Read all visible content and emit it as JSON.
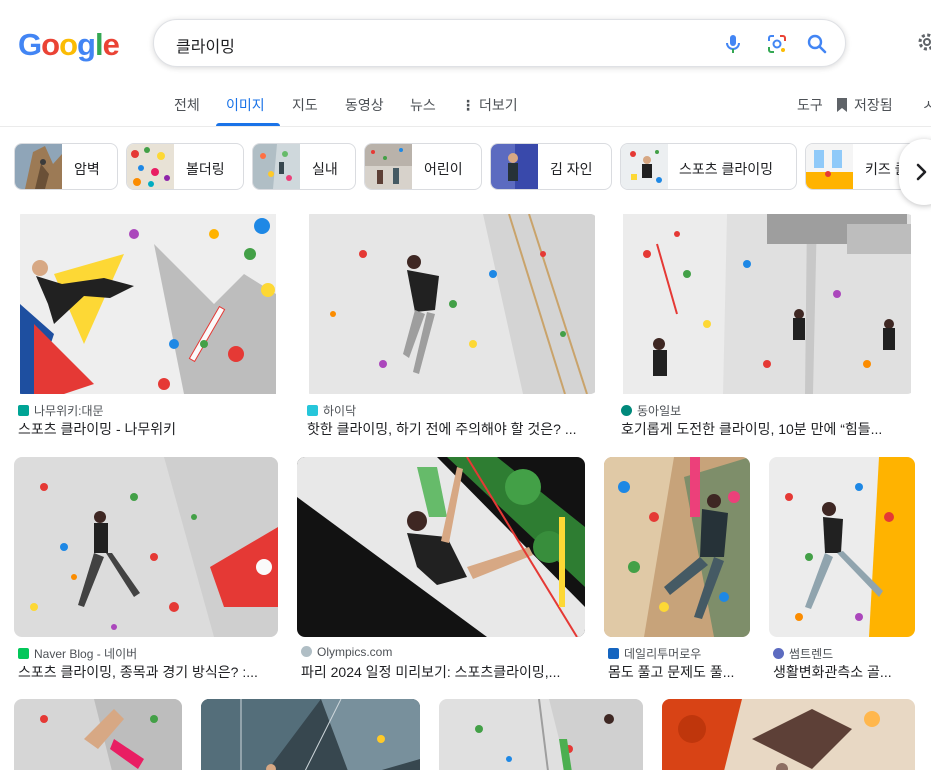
{
  "logo": [
    "G",
    "o",
    "o",
    "g",
    "l",
    "e"
  ],
  "search": {
    "query": "클라이밍"
  },
  "tabs": [
    {
      "label": "전체"
    },
    {
      "label": "이미지"
    },
    {
      "label": "지도"
    },
    {
      "label": "동영상"
    },
    {
      "label": "뉴스"
    },
    {
      "label": "더보기"
    },
    {
      "label": "도구"
    },
    {
      "label": "저장됨"
    }
  ],
  "chips": [
    {
      "label": "암벽"
    },
    {
      "label": "볼더링"
    },
    {
      "label": "실내"
    },
    {
      "label": "어린이"
    },
    {
      "label": "김 자인"
    },
    {
      "label": "스포츠 클라이밍"
    },
    {
      "label": "키즈 클"
    }
  ],
  "results": [
    {
      "source": "나무위키:대문",
      "title": "스포츠 클라이밍 - 나무위키"
    },
    {
      "source": "하이닥",
      "title": "핫한 클라이밍, 하기 전에 주의해야 할 것은? ..."
    },
    {
      "source": "동아일보",
      "title": "호기롭게 도전한 클라이밍, 10분 만에 “힘들..."
    },
    {
      "source": "Naver Blog - 네이버",
      "title": "스포츠 클라이밍, 종목과 경기 방식은? :..."
    },
    {
      "source": "Olympics.com",
      "title": "파리 2024 일정 미리보기: 스포츠클라이밍,..."
    },
    {
      "source": "데일리투머로우",
      "title": "몸도 풀고 문제도 풀..."
    },
    {
      "source": "썸트렌드",
      "title": "생활변화관측소 골..."
    }
  ],
  "colors": {
    "accent": "#1a73e8",
    "text": "#202124",
    "muted": "#4d5156"
  }
}
